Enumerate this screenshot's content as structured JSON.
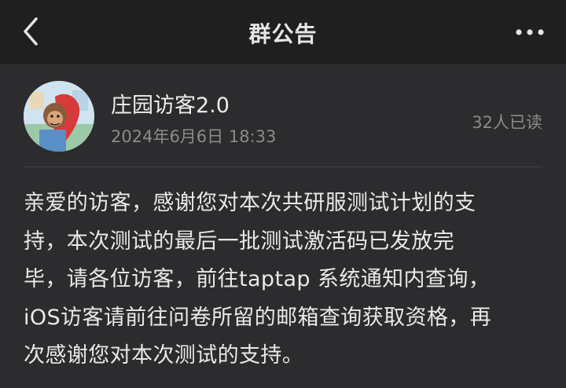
{
  "header": {
    "title": "群公告",
    "back_icon": "chevron-left-icon",
    "more_icon": "more-horizontal-icon"
  },
  "announcement": {
    "author": "庄园访客2.0",
    "datetime": "2024年6月6日 18:33",
    "read_count": "32人已读",
    "lines": [
      "亲爱的访客，感谢您对本次共研服测试计划的支",
      "持，本次测试的最后一批测试激活码已发放完",
      "毕，请各位访客，前往taptap 系统通知内查询，",
      "iOS访客请前往问卷所留的邮箱查询获取资格，再",
      "次感谢您对本次测试的支持。"
    ]
  },
  "colors": {
    "header_bg": "#1f1f1f",
    "page_bg": "#2c2c2e",
    "primary_text": "#e9e9e9",
    "secondary_text": "#8b8b8b"
  }
}
